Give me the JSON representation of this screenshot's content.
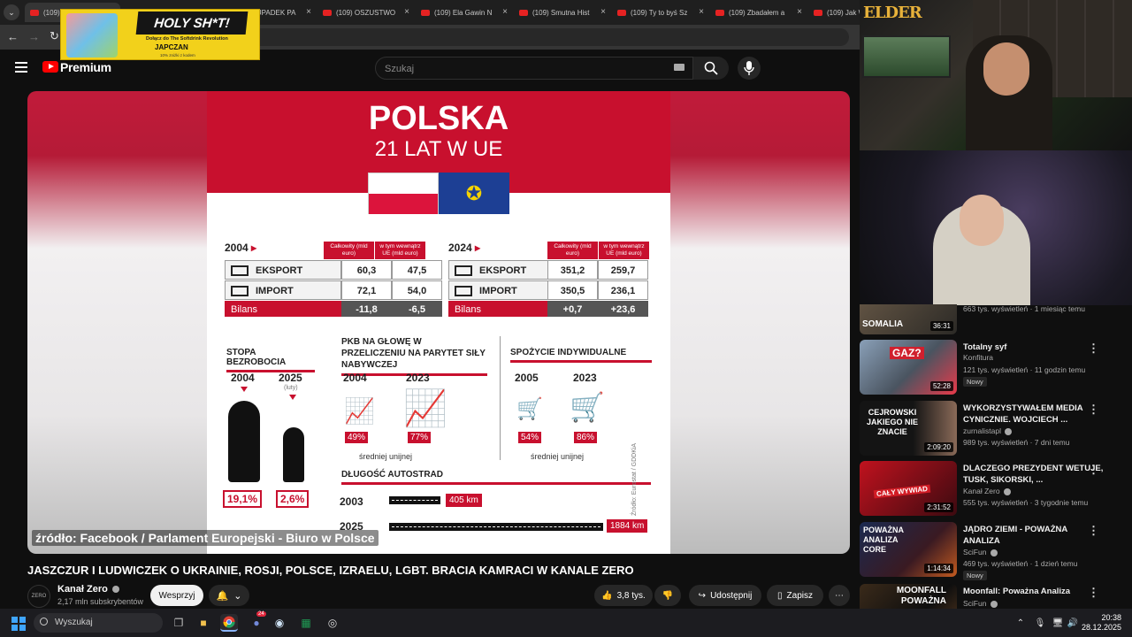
{
  "browser": {
    "tabs": [
      {
        "label": "(109) JASZCZU"
      },
      {
        "label": "(109) UPADEK PA"
      },
      {
        "label": "(109) OSZUSTWO"
      },
      {
        "label": "(109) Ela Gawin N"
      },
      {
        "label": "(109) Smutna Hist"
      },
      {
        "label": "(109) Ty to byś Sz"
      },
      {
        "label": "(109) Zbadałem a"
      },
      {
        "label": "(109) Jak W"
      }
    ]
  },
  "ad": {
    "title": "HOLY SH*T!",
    "subtitle": "Dołącz do The Softdrink Revolution",
    "brand": "JAPCZAN",
    "small": "10% zniżki z kodem"
  },
  "youtube": {
    "logo_text": "Premium",
    "search_placeholder": "Szukaj"
  },
  "infographic": {
    "title": "POLSKA",
    "subtitle": "21 LAT W UE",
    "col_total": "Całkowity (mld euro)",
    "col_eu": "w tym wewnątrz UE (mld euro)",
    "table_2004": {
      "year": "2004",
      "rows": [
        {
          "label": "EKSPORT",
          "total": "60,3",
          "eu": "47,5"
        },
        {
          "label": "IMPORT",
          "total": "72,1",
          "eu": "54,0"
        },
        {
          "label": "Bilans",
          "total": "-11,8",
          "eu": "-6,5"
        }
      ]
    },
    "table_2024": {
      "year": "2024",
      "rows": [
        {
          "label": "EKSPORT",
          "total": "351,2",
          "eu": "259,7"
        },
        {
          "label": "IMPORT",
          "total": "350,5",
          "eu": "236,1"
        },
        {
          "label": "Bilans",
          "total": "+0,7",
          "eu": "+23,6"
        }
      ]
    },
    "unemployment": {
      "title": "STOPA BEZROBOCIA",
      "y1": "2004",
      "y2": "2025",
      "y2_note": "(luty)",
      "v1": "19,1%",
      "v2": "2,6%"
    },
    "gdp": {
      "title": "PKB NA GŁOWĘ W PRZELICZENIU NA PARYTET SIŁY NABYWCZEJ",
      "y1": "2004",
      "y2": "2023",
      "v1": "49%",
      "v2": "77%",
      "note": "średniej unijnej"
    },
    "consumption": {
      "title": "SPOŻYCIE INDYWIDUALNE",
      "y1": "2005",
      "y2": "2023",
      "v1": "54%",
      "v2": "86%",
      "note": "średniej unijnej"
    },
    "motorways": {
      "title": "DŁUGOŚĆ AUTOSTRAD",
      "y1": "2003",
      "v1": "405 km",
      "y2": "2025",
      "v2": "1884 km"
    },
    "source": "Źródło: Eurostat / GDDKiA"
  },
  "video": {
    "caption": "źródło: Facebook / Parlament Europejski - Biuro w Polsce",
    "title": "JASZCZUR I LUDWICZEK O UKRAINIE, ROSJI, POLSCE, IZRAELU, LGBT. BRACIA KAMRACI W KANALE ZERO",
    "channel": "Kanał Zero",
    "subscribers": "2,17 mln subskrybentów",
    "support_label": "Wesprzyj",
    "likes": "3,8 tys.",
    "share_label": "Udostępnij",
    "save_label": "Zapisz"
  },
  "stream": {
    "overlay_logo": "ELDER"
  },
  "recommendations": [
    {
      "title": "",
      "thumb_text": "SOMALIA",
      "duration": "36:31",
      "channel": "",
      "meta": "663 tys. wyświetleń · 1 miesiąc temu",
      "badge": ""
    },
    {
      "title": "Totalny syf",
      "thumb_text": "GAZ?",
      "duration": "52:28",
      "channel": "Konfitura",
      "meta": "121 tys. wyświetleń · 11 godzin temu",
      "badge": "Nowy"
    },
    {
      "title": "WYKORZYSTYWAŁEM MEDIA CYNICZNIE. WOJCIECH ...",
      "thumb_text": "CEJROWSKI JAKIEGO NIE ZNACIE",
      "duration": "2:09:20",
      "channel": "zurnalistapl",
      "meta": "989 tys. wyświetleń · 7 dni temu",
      "badge": ""
    },
    {
      "title": "DLACZEGO PREZYDENT WETUJE, TUSK, SIKORSKI, ...",
      "thumb_text": "CAŁY WYWIAD",
      "duration": "2:31:52",
      "channel": "Kanał Zero",
      "meta": "555 tys. wyświetleń · 3 tygodnie temu",
      "badge": ""
    },
    {
      "title": "JĄDRO ZIEMI - POWAŻNA ANALIZA",
      "thumb_text": "POWAŻNA ANALIZA CORE",
      "duration": "1:14:34",
      "channel": "SciFun",
      "meta": "469 tys. wyświetleń · 1 dzień temu",
      "badge": "Nowy"
    },
    {
      "title": "Moonfall: Poważna Analiza",
      "thumb_text": "MOONFALL POWAŻNA",
      "duration": "",
      "channel": "SciFun",
      "meta": "",
      "badge": ""
    }
  ],
  "taskbar": {
    "search_placeholder": "Wyszukaj",
    "time": "20:38",
    "date": "28.12.2025",
    "discord_badge": "24"
  }
}
